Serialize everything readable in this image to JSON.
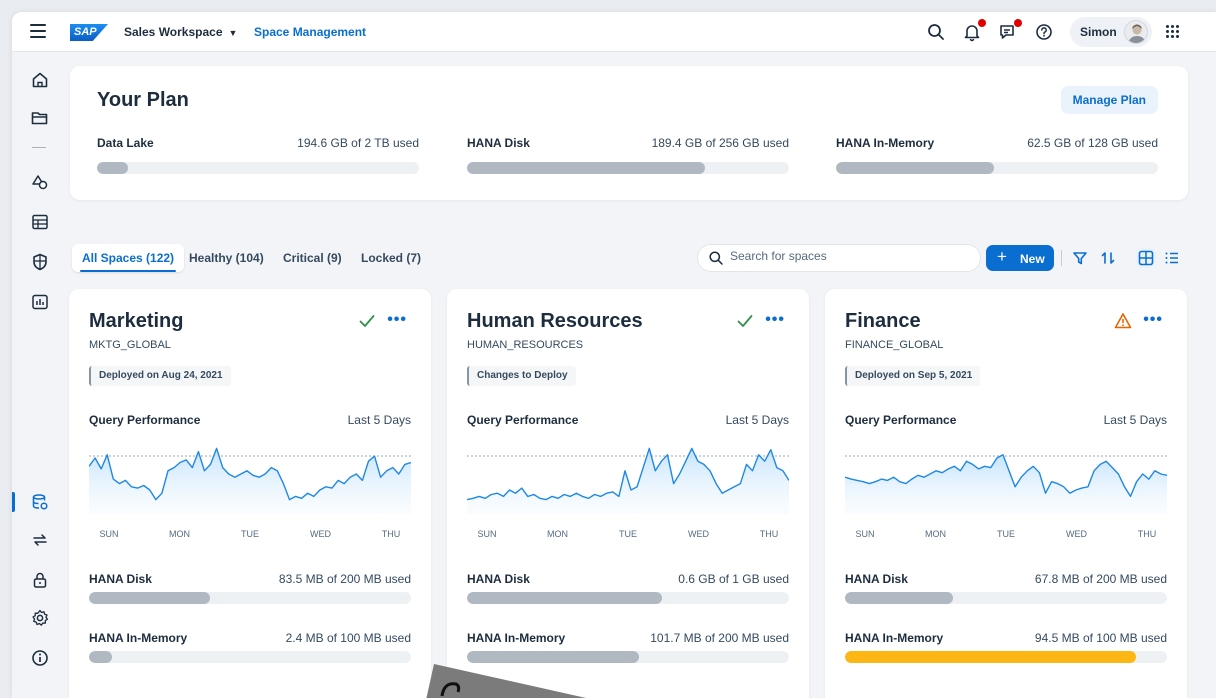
{
  "shell": {
    "logo_text": "SAP",
    "workspace": "Sales Workspace",
    "section": "Space Management",
    "user_name": "Simon",
    "icons": [
      "menu-icon",
      "search-icon",
      "bell-icon",
      "feedback-icon",
      "help-icon",
      "apps-grid-icon"
    ]
  },
  "sidenav": {
    "items": [
      "home-icon",
      "folder-icon",
      "shapes-icon",
      "table-icon",
      "shield-icon",
      "analytics-icon",
      "space-management-icon",
      "transport-icon",
      "lock-icon",
      "settings-icon",
      "info-icon"
    ],
    "active": "space-management-icon"
  },
  "plan": {
    "title": "Your Plan",
    "manage_label": "Manage Plan",
    "meters": [
      {
        "label": "Data Lake",
        "value": "194.6 GB of 2 TB used",
        "fraction": 0.095
      },
      {
        "label": "HANA Disk",
        "value": "189.4 GB of 256 GB used",
        "fraction": 0.74
      },
      {
        "label": "HANA In-Memory",
        "value": "62.5 GB of 128 GB used",
        "fraction": 0.49
      }
    ]
  },
  "tabs": [
    {
      "label": "All Spaces (122)",
      "active": true
    },
    {
      "label": "Healthy (104)",
      "active": false
    },
    {
      "label": "Critical (9)",
      "active": false
    },
    {
      "label": "Locked (7)",
      "active": false
    }
  ],
  "toolbar": {
    "search_placeholder": "Search for spaces",
    "new_label": "New",
    "icons": [
      "filter-icon",
      "sort-icon",
      "grid-view-icon",
      "list-view-icon"
    ]
  },
  "days": [
    "SUN",
    "MON",
    "TUE",
    "WED",
    "THU"
  ],
  "cards": [
    {
      "name": "Marketing",
      "code": "MKTG_GLOBAL",
      "status": "healthy",
      "tag": "Deployed on Aug 24, 2021",
      "perf_label": "Query Performance",
      "perf_range": "Last 5 Days",
      "series": [
        0.62,
        0.75,
        0.58,
        0.8,
        0.42,
        0.35,
        0.4,
        0.3,
        0.28,
        0.32,
        0.25,
        0.1,
        0.2,
        0.55,
        0.6,
        0.68,
        0.72,
        0.6,
        0.85,
        0.55,
        0.65,
        0.9,
        0.6,
        0.5,
        0.45,
        0.5,
        0.55,
        0.48,
        0.45,
        0.5,
        0.6,
        0.55,
        0.35,
        0.1,
        0.15,
        0.12,
        0.2,
        0.15,
        0.25,
        0.3,
        0.28,
        0.4,
        0.35,
        0.45,
        0.5,
        0.4,
        0.7,
        0.78,
        0.45,
        0.55,
        0.6,
        0.5,
        0.65,
        0.68
      ],
      "disk_label": "HANA Disk",
      "disk_value": "83.5 MB of 200 MB used",
      "disk_fraction": 0.375,
      "mem_label": "HANA In-Memory",
      "mem_value": "2.4 MB of 100 MB used",
      "mem_fraction": 0.07,
      "mem_color": "#b0b8c2"
    },
    {
      "name": "Human Resources",
      "code": "HUMAN_RESOURCES",
      "status": "healthy",
      "tag": "Changes to Deploy",
      "perf_label": "Query Performance",
      "perf_range": "Last 5 Days",
      "series": [
        0.1,
        0.12,
        0.15,
        0.12,
        0.18,
        0.2,
        0.15,
        0.25,
        0.2,
        0.28,
        0.15,
        0.18,
        0.12,
        0.1,
        0.15,
        0.12,
        0.18,
        0.15,
        0.2,
        0.15,
        0.12,
        0.18,
        0.15,
        0.2,
        0.22,
        0.15,
        0.55,
        0.25,
        0.3,
        0.6,
        0.9,
        0.55,
        0.7,
        0.8,
        0.35,
        0.5,
        0.7,
        0.9,
        0.7,
        0.65,
        0.55,
        0.35,
        0.2,
        0.25,
        0.3,
        0.35,
        0.65,
        0.55,
        0.8,
        0.7,
        0.88,
        0.6,
        0.55,
        0.4
      ],
      "disk_label": "HANA Disk",
      "disk_value": "0.6 GB of 1 GB used",
      "disk_fraction": 0.605,
      "mem_label": "HANA In-Memory",
      "mem_value": "101.7 MB of 200 MB used",
      "mem_fraction": 0.535,
      "mem_color": "#b0b8c2"
    },
    {
      "name": "Finance",
      "code": "FINANCE_GLOBAL",
      "status": "warning",
      "tag": "Deployed on Sep 5, 2021",
      "perf_label": "Query Performance",
      "perf_range": "Last 5 Days",
      "series": [
        0.45,
        0.42,
        0.4,
        0.38,
        0.35,
        0.38,
        0.42,
        0.4,
        0.45,
        0.38,
        0.35,
        0.42,
        0.48,
        0.45,
        0.5,
        0.55,
        0.52,
        0.58,
        0.62,
        0.55,
        0.7,
        0.65,
        0.58,
        0.62,
        0.6,
        0.75,
        0.8,
        0.55,
        0.3,
        0.45,
        0.55,
        0.62,
        0.52,
        0.2,
        0.38,
        0.35,
        0.3,
        0.2,
        0.25,
        0.28,
        0.3,
        0.55,
        0.65,
        0.7,
        0.6,
        0.5,
        0.3,
        0.15,
        0.38,
        0.5,
        0.42,
        0.55,
        0.5,
        0.48
      ],
      "disk_label": "HANA Disk",
      "disk_value": "67.8 MB of 200 MB used",
      "disk_fraction": 0.335,
      "mem_label": "HANA In-Memory",
      "mem_value": "94.5 MB of 100 MB used",
      "mem_fraction": 0.905,
      "mem_color": "#fdb714"
    }
  ],
  "colors": {
    "accent": "#0a6ed1",
    "healthy": "#30914c",
    "warning": "#e76500",
    "bar": "#b0b8c2",
    "critical_bar": "#fdb714",
    "chart_line": "#1e88e5"
  }
}
